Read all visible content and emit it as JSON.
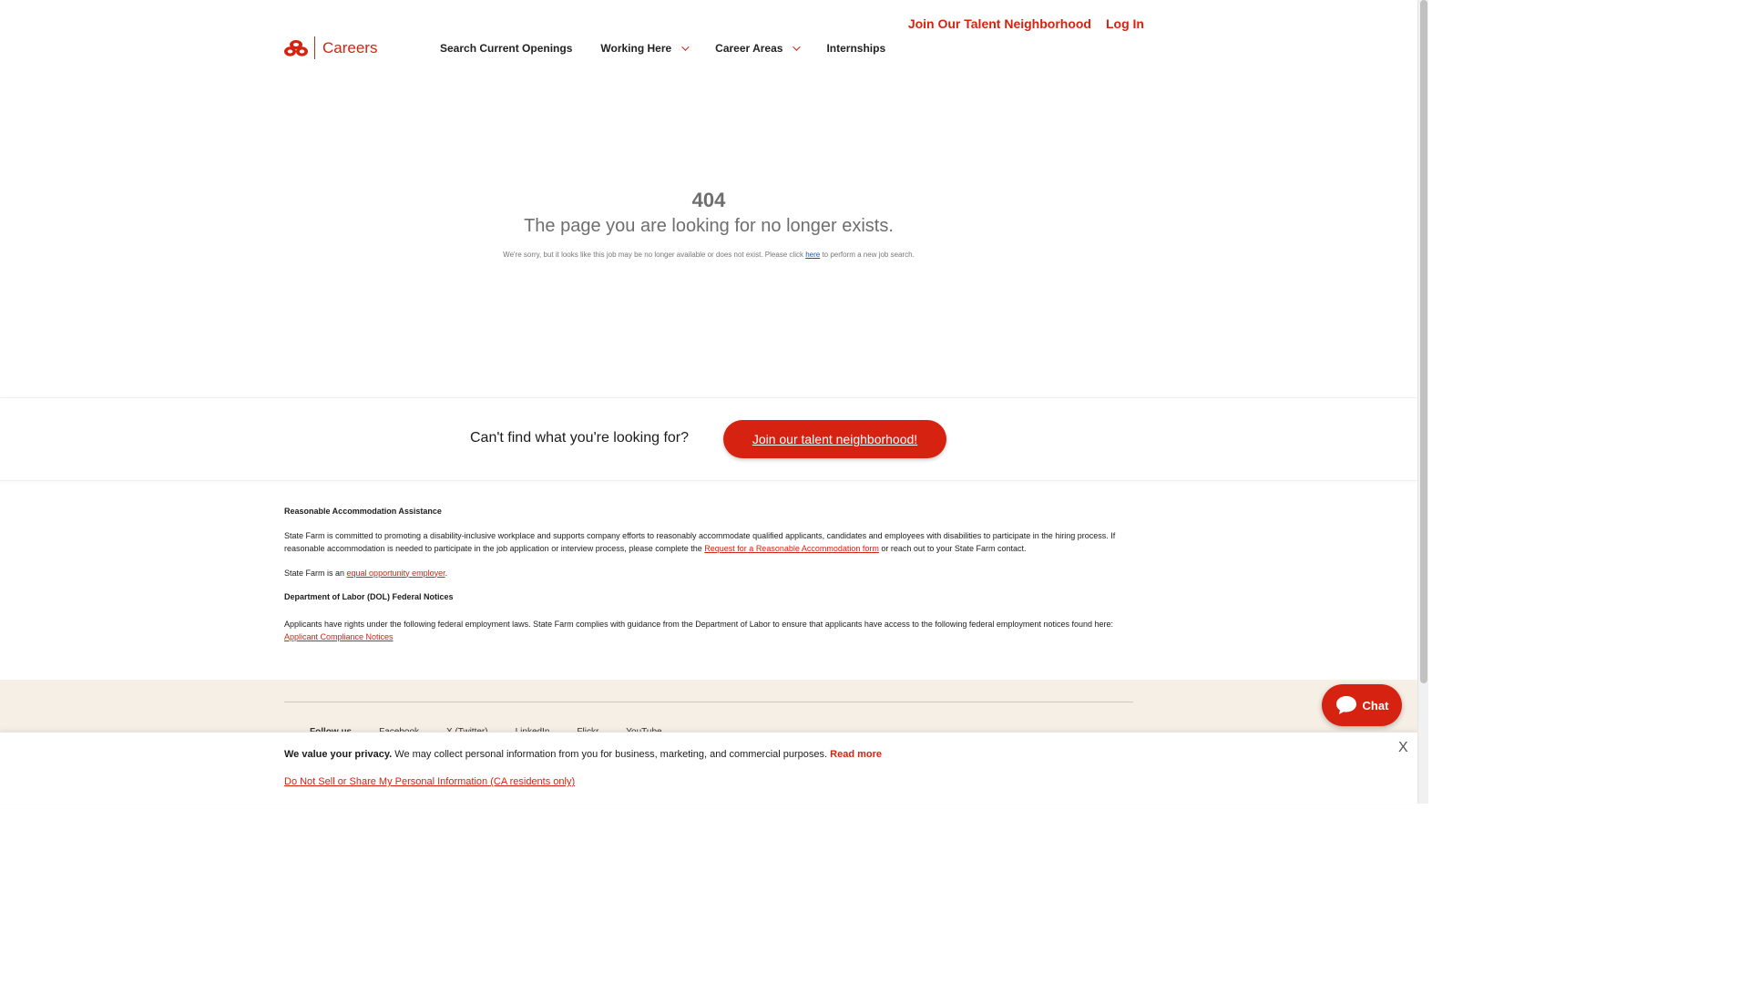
{
  "header": {
    "util_links": [
      "Join Our Talent Neighborhood",
      "Log In"
    ],
    "brand_label": "Careers",
    "nav": [
      {
        "label": "Search Current Openings",
        "has_dropdown": false
      },
      {
        "label": "Working Here",
        "has_dropdown": true
      },
      {
        "label": "Career Areas",
        "has_dropdown": true
      },
      {
        "label": "Internships",
        "has_dropdown": false
      }
    ]
  },
  "error": {
    "code": "404",
    "headline": "The page you are looking for no longer exists.",
    "message_before": "We're sorry, but it looks like this job may be no longer available or does not exist. Please click ",
    "message_link": "here",
    "message_after": " to perform a new job search."
  },
  "cta": {
    "question": "Can't find what you're looking for?",
    "button_label": "Join our talent neighborhood!"
  },
  "legal": {
    "heading1": "Reasonable Accommodation Assistance",
    "para1_before": "State Farm is committed to promoting a disability-inclusive workplace and supports company efforts to reasonably accommodate qualified applicants, candidates and employees with disabilities to participate in the hiring process. If reasonable accommodation is needed to participate in the job application or interview process, please complete the ",
    "para1_link": "Request for a Reasonable Accommodation form",
    "para1_after": " or reach out to your State Farm contact.",
    "para2_before": "State Farm is an ",
    "para2_link": "equal opportunity employer",
    "para2_after": ".",
    "heading2": "Department of Labor (DOL) Federal Notices",
    "para3_before": "Applicants have rights under the following federal employment laws. State Farm complies with guidance from the Department of Labor to ensure that applicants have access to the following federal employment notices found here: ",
    "para3_link": "Applicant Compliance Notices"
  },
  "footer": {
    "social": [
      "Follow us",
      "Facebook",
      "X (Twitter)",
      "LinkedIn",
      "Flickr",
      "YouTube"
    ]
  },
  "chat": {
    "label": "Chat"
  },
  "privacy": {
    "lead": "We value your privacy.",
    "text": " We may collect personal information from you for business, marketing, and commercial purposes. ",
    "read_more": "Read more",
    "do_not_sell": "Do Not Sell or Share My Personal Information (CA residents only)",
    "close": "X"
  },
  "colors": {
    "accent": "#d62311",
    "footer_bg": "#f5efe6",
    "link_blue": "#1a55c8"
  },
  "icons": {
    "logo": "state-farm-logo-icon",
    "chat": "chat-bubble-icon",
    "dropdown": "chevron-down-icon"
  }
}
